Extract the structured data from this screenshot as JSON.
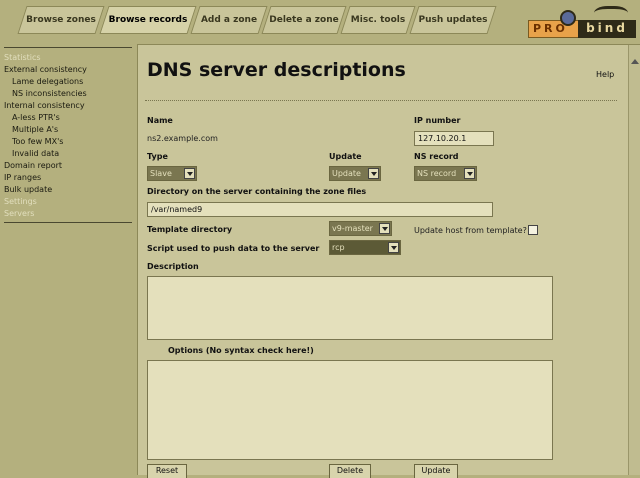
{
  "top_tabs": [
    {
      "label": "Browse zones"
    },
    {
      "label": "Browse records"
    },
    {
      "label": "Add a zone"
    },
    {
      "label": "Delete a zone"
    },
    {
      "label": "Misc. tools"
    },
    {
      "label": "Push updates"
    }
  ],
  "logo": {
    "left": "PRO",
    "right": "bind"
  },
  "sidebar": {
    "items": [
      {
        "label": "Statistics"
      },
      {
        "label": "External consistency"
      },
      {
        "label": "Lame delegations"
      },
      {
        "label": "NS inconsistencies"
      },
      {
        "label": "Internal consistency"
      },
      {
        "label": "A-less PTR's"
      },
      {
        "label": "Multiple A's"
      },
      {
        "label": "Too few MX's"
      },
      {
        "label": "Invalid data"
      },
      {
        "label": "Domain report"
      },
      {
        "label": "IP ranges"
      },
      {
        "label": "Bulk update"
      },
      {
        "label": "Settings"
      },
      {
        "label": "Servers"
      }
    ]
  },
  "main": {
    "title": "DNS server descriptions",
    "help_label": "Help",
    "name_label": "Name",
    "name_value": "ns2.example.com",
    "ip_label": "IP number",
    "ip_value": "127.10.20.1",
    "type_label": "Type",
    "type_value": "Slave",
    "update_label": "Update",
    "update_value": "Update",
    "nsrecord_label": "NS record",
    "nsrecord_value": "NS record",
    "directory_label": "Directory on the server containing the zone files",
    "directory_value": "/var/named9",
    "template_label": "Template directory",
    "template_value": "v9-master",
    "update_host_label": "Update host from template?",
    "script_label": "Script used to push data to the server",
    "script_value": "rcp",
    "description_label": "Description",
    "options_label": "Options (No syntax check here!)",
    "reset_label": "Reset",
    "delete_label": "Delete",
    "update_button_label": "Update"
  }
}
